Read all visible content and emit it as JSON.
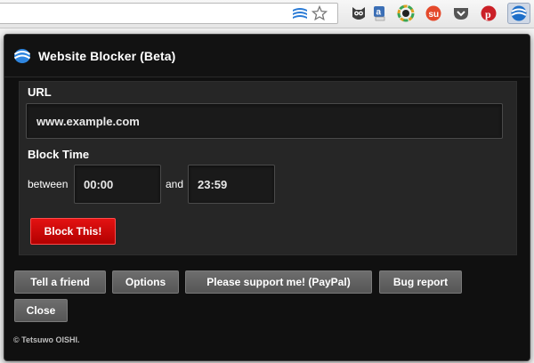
{
  "popup": {
    "title": "Website Blocker (Beta)",
    "url_label": "URL",
    "url_value": "www.example.com",
    "block_time_label": "Block Time",
    "between_label": "between",
    "start_time": "00:00",
    "and_label": "and",
    "end_time": "23:59",
    "block_button": "Block This!",
    "footer_buttons": {
      "tell_friend": "Tell a friend",
      "options": "Options",
      "support": "Please support me! (PayPal)",
      "bug_report": "Bug report",
      "close": "Close"
    },
    "copyright": "© Tetsuwo OISHI."
  },
  "toolbar": {
    "icons": [
      "website-blocker-icon",
      "star-icon",
      "owl-icon",
      "amazon-icon",
      "color-wheel-icon",
      "stumbleupon-icon",
      "pocket-icon",
      "pinterest-icon",
      "website-blocker-active-icon"
    ]
  },
  "colors": {
    "popup_bg": "#101010",
    "panel_bg": "#262626",
    "block_button": "#d40b0b",
    "gray_button": "#616161"
  }
}
